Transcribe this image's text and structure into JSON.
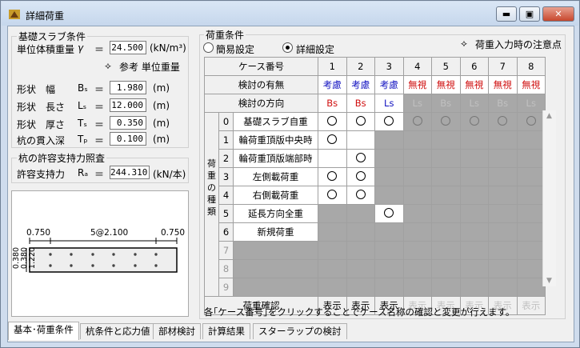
{
  "window": {
    "title": "詳細荷重",
    "min": "▬",
    "max": "▣",
    "close": "✕"
  },
  "left": {
    "group1_title": "基礎スラブ条件",
    "unit_weight": {
      "label": "単位体積重量",
      "sym": "γ",
      "eq": "＝",
      "value": "24.500",
      "unit": "(kN/m³)"
    },
    "ref_label": "参考 単位重量",
    "width": {
      "label": "形状　幅",
      "sym": "Bₛ",
      "eq": "＝",
      "value": "1.980",
      "unit": "(m)"
    },
    "length": {
      "label": "形状　長さ",
      "sym": "Lₛ",
      "eq": "＝",
      "value": "12.000",
      "unit": "(m)"
    },
    "thick": {
      "label": "形状　厚さ",
      "sym": "Tₛ",
      "eq": "＝",
      "value": "0.350",
      "unit": "(m)"
    },
    "pen": {
      "label": "杭の貫入深",
      "sym": "Tₚ",
      "eq": "＝",
      "value": "0.100",
      "unit": "(m)"
    },
    "group2_title": "杭の許容支持力照査",
    "allow": {
      "label": "許容支持力",
      "sym": "Rₐ",
      "eq": "＝",
      "value": "244.310",
      "unit": "(kN/本)"
    }
  },
  "diagram": {
    "dim_left": "0.750",
    "dim_mid": "5@2.100",
    "dim_right": "0.750",
    "v1": "0.380",
    "v2": "0.380",
    "v3": "1.220"
  },
  "right": {
    "group_title": "荷重条件",
    "radio_simple": "簡易設定",
    "radio_detail": "詳細設定",
    "notice": "荷重入力時の注意点",
    "hdr_case": "ケース番号",
    "hdr_enable": "検討の有無",
    "hdr_dir": "検討の方向",
    "side_label": "荷重の種類",
    "confirm_label": "荷重確認",
    "cases": [
      "1",
      "2",
      "3",
      "4",
      "5",
      "6",
      "7",
      "8"
    ],
    "enable": [
      "考慮",
      "考慮",
      "考慮",
      "無視",
      "無視",
      "無視",
      "無視",
      "無視"
    ],
    "dirs": [
      "Bs",
      "Bs",
      "Ls",
      "Ls",
      "Bs",
      "Ls",
      "Bs",
      "Ls"
    ],
    "rows": [
      {
        "n": "0",
        "name": "基礎スラブ自重"
      },
      {
        "n": "1",
        "name": "輪荷重頂版中央時"
      },
      {
        "n": "2",
        "name": "輪荷重頂版端部時"
      },
      {
        "n": "3",
        "name": "左側載荷重"
      },
      {
        "n": "4",
        "name": "右側載荷重"
      },
      {
        "n": "5",
        "name": "延長方向全重"
      },
      {
        "n": "6",
        "name": "新規荷重"
      },
      {
        "n": "7",
        "name": ""
      },
      {
        "n": "8",
        "name": ""
      },
      {
        "n": "9",
        "name": ""
      }
    ],
    "show": "表示",
    "footer": "各｢ケース番号｣をクリックすることでケース名称の確認と変更が行えます。"
  },
  "tabs": [
    "基本･荷重条件",
    "杭条件と応力値",
    "部材検討",
    "計算結果",
    "スターラップの検討"
  ]
}
